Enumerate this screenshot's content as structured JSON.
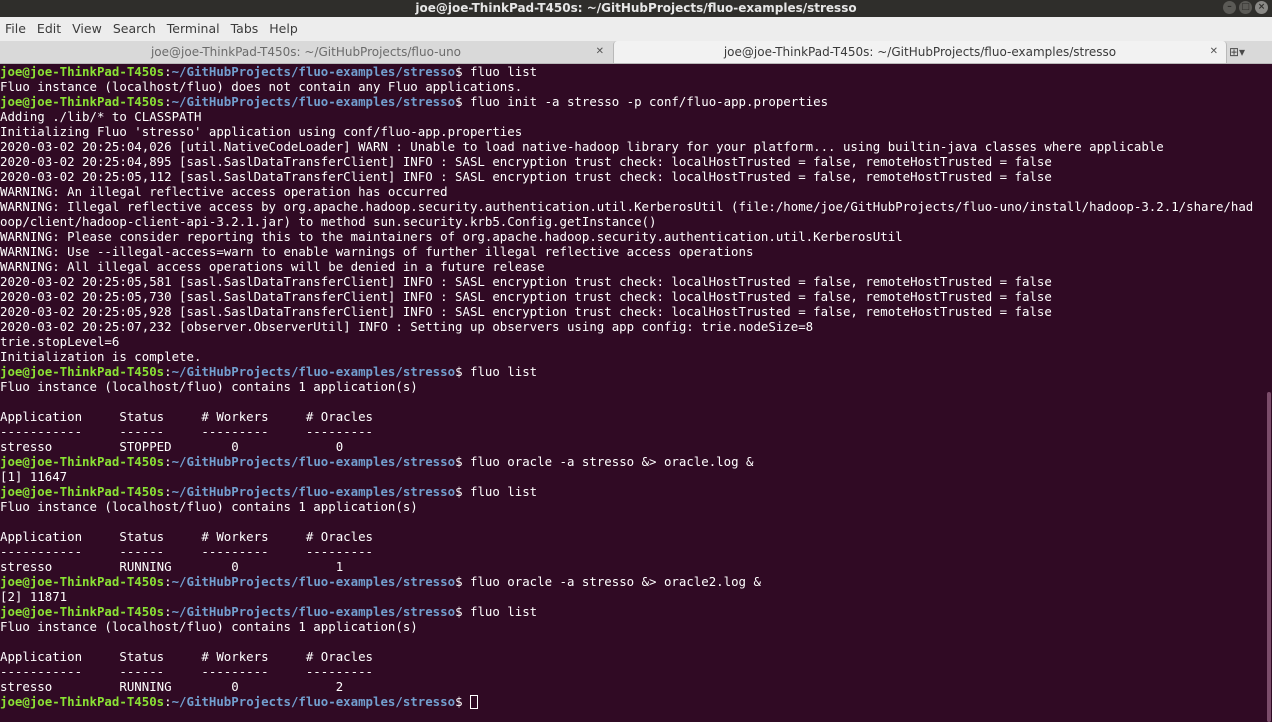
{
  "window": {
    "title": "joe@joe-ThinkPad-T450s: ~/GitHubProjects/fluo-examples/stresso"
  },
  "menu": [
    "File",
    "Edit",
    "View",
    "Search",
    "Terminal",
    "Tabs",
    "Help"
  ],
  "tabs": [
    {
      "label": "joe@joe-ThinkPad-T450s: ~/GitHubProjects/fluo-uno",
      "active": false
    },
    {
      "label": "joe@joe-ThinkPad-T450s: ~/GitHubProjects/fluo-examples/stresso",
      "active": true
    }
  ],
  "prompt": {
    "user": "joe@joe-ThinkPad-T450s",
    "path": "~/GitHubProjects/fluo-examples/stresso"
  },
  "colors": {
    "background": "#300a24",
    "prompt_user": "#8ae234",
    "prompt_path": "#729fcf",
    "text": "#ffffff"
  },
  "lines": [
    {
      "type": "prompt",
      "cmd": "fluo list"
    },
    {
      "type": "out",
      "text": "Fluo instance (localhost/fluo) does not contain any Fluo applications."
    },
    {
      "type": "prompt",
      "cmd": "fluo init -a stresso -p conf/fluo-app.properties"
    },
    {
      "type": "out",
      "text": "Adding ./lib/* to CLASSPATH"
    },
    {
      "type": "out",
      "text": "Initializing Fluo 'stresso' application using conf/fluo-app.properties"
    },
    {
      "type": "out",
      "text": "2020-03-02 20:25:04,026 [util.NativeCodeLoader] WARN : Unable to load native-hadoop library for your platform... using builtin-java classes where applicable"
    },
    {
      "type": "out",
      "text": "2020-03-02 20:25:04,895 [sasl.SaslDataTransferClient] INFO : SASL encryption trust check: localHostTrusted = false, remoteHostTrusted = false"
    },
    {
      "type": "out",
      "text": "2020-03-02 20:25:05,112 [sasl.SaslDataTransferClient] INFO : SASL encryption trust check: localHostTrusted = false, remoteHostTrusted = false"
    },
    {
      "type": "out",
      "text": "WARNING: An illegal reflective access operation has occurred"
    },
    {
      "type": "out",
      "text": "WARNING: Illegal reflective access by org.apache.hadoop.security.authentication.util.KerberosUtil (file:/home/joe/GitHubProjects/fluo-uno/install/hadoop-3.2.1/share/had"
    },
    {
      "type": "out",
      "text": "oop/client/hadoop-client-api-3.2.1.jar) to method sun.security.krb5.Config.getInstance()"
    },
    {
      "type": "out",
      "text": "WARNING: Please consider reporting this to the maintainers of org.apache.hadoop.security.authentication.util.KerberosUtil"
    },
    {
      "type": "out",
      "text": "WARNING: Use --illegal-access=warn to enable warnings of further illegal reflective access operations"
    },
    {
      "type": "out",
      "text": "WARNING: All illegal access operations will be denied in a future release"
    },
    {
      "type": "out",
      "text": "2020-03-02 20:25:05,581 [sasl.SaslDataTransferClient] INFO : SASL encryption trust check: localHostTrusted = false, remoteHostTrusted = false"
    },
    {
      "type": "out",
      "text": "2020-03-02 20:25:05,730 [sasl.SaslDataTransferClient] INFO : SASL encryption trust check: localHostTrusted = false, remoteHostTrusted = false"
    },
    {
      "type": "out",
      "text": "2020-03-02 20:25:05,928 [sasl.SaslDataTransferClient] INFO : SASL encryption trust check: localHostTrusted = false, remoteHostTrusted = false"
    },
    {
      "type": "out",
      "text": "2020-03-02 20:25:07,232 [observer.ObserverUtil] INFO : Setting up observers using app config: trie.nodeSize=8"
    },
    {
      "type": "out",
      "text": "trie.stopLevel=6"
    },
    {
      "type": "out",
      "text": "Initialization is complete."
    },
    {
      "type": "prompt",
      "cmd": "fluo list"
    },
    {
      "type": "out",
      "text": "Fluo instance (localhost/fluo) contains 1 application(s)"
    },
    {
      "type": "out",
      "text": ""
    },
    {
      "type": "out",
      "text": "Application     Status     # Workers     # Oracles"
    },
    {
      "type": "out",
      "text": "-----------     ------     ---------     ---------"
    },
    {
      "type": "out",
      "text": "stresso         STOPPED        0             0"
    },
    {
      "type": "prompt",
      "cmd": "fluo oracle -a stresso &> oracle.log &"
    },
    {
      "type": "out",
      "text": "[1] 11647"
    },
    {
      "type": "prompt",
      "cmd": "fluo list"
    },
    {
      "type": "out",
      "text": "Fluo instance (localhost/fluo) contains 1 application(s)"
    },
    {
      "type": "out",
      "text": ""
    },
    {
      "type": "out",
      "text": "Application     Status     # Workers     # Oracles"
    },
    {
      "type": "out",
      "text": "-----------     ------     ---------     ---------"
    },
    {
      "type": "out",
      "text": "stresso         RUNNING        0             1"
    },
    {
      "type": "prompt",
      "cmd": "fluo oracle -a stresso &> oracle2.log &"
    },
    {
      "type": "out",
      "text": "[2] 11871"
    },
    {
      "type": "prompt",
      "cmd": "fluo list"
    },
    {
      "type": "out",
      "text": "Fluo instance (localhost/fluo) contains 1 application(s)"
    },
    {
      "type": "out",
      "text": ""
    },
    {
      "type": "out",
      "text": "Application     Status     # Workers     # Oracles"
    },
    {
      "type": "out",
      "text": "-----------     ------     ---------     ---------"
    },
    {
      "type": "out",
      "text": "stresso         RUNNING        0             2"
    },
    {
      "type": "prompt",
      "cmd": "",
      "cursor": true
    }
  ]
}
